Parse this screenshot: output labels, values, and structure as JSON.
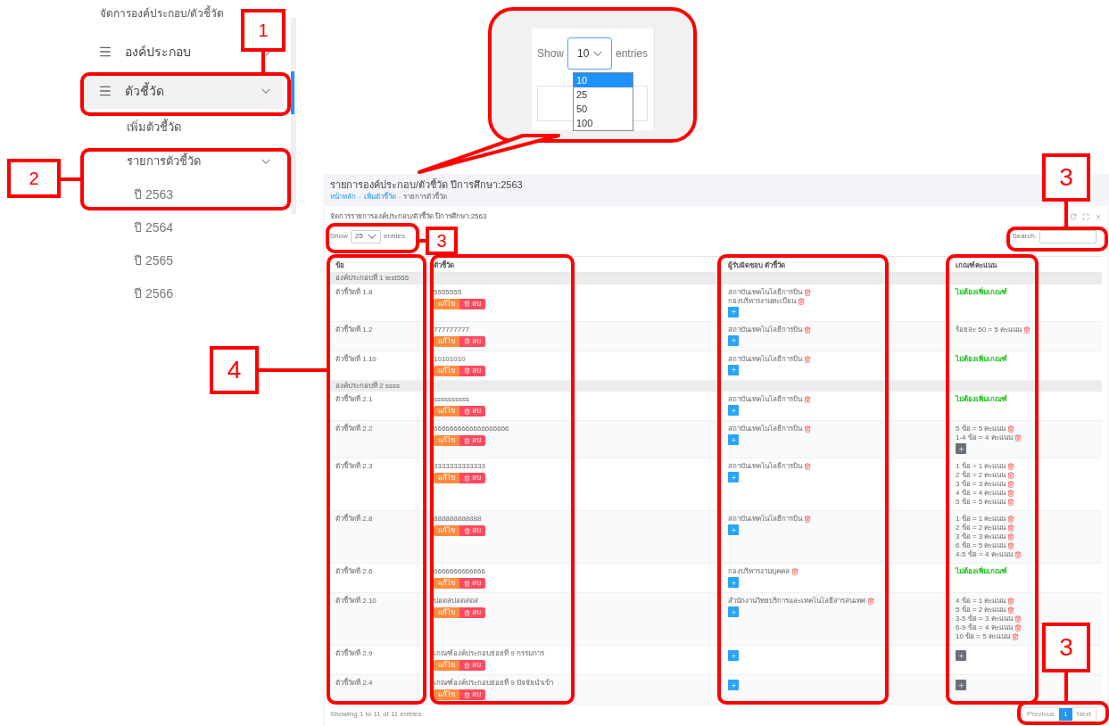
{
  "sidebar": {
    "heading": "จัดการองค์ประกอบ/ตัวชี้วัด",
    "items": [
      {
        "label": "องค์ประกอบ",
        "selected": false,
        "expanded": false
      },
      {
        "label": "ตัวชี้วัด",
        "selected": true,
        "expanded": true,
        "children": [
          {
            "label": "เพิ่มตัวชี้วัด"
          },
          {
            "label": "รายการตัวชี้วัด",
            "expanded": true,
            "children": [
              {
                "label": "ปี 2563"
              },
              {
                "label": "ปี 2564"
              },
              {
                "label": "ปี 2565"
              },
              {
                "label": "ปี 2566"
              }
            ]
          }
        ]
      }
    ]
  },
  "callout": {
    "show": "Show",
    "value": "10",
    "entries": "entries",
    "options": [
      {
        "label": "10",
        "selected": true
      },
      {
        "label": "25",
        "selected": false
      },
      {
        "label": "50",
        "selected": false
      },
      {
        "label": "100",
        "selected": false
      }
    ]
  },
  "page": {
    "title": "รายการองค์ประกอบ/ตัวชี้วัด ปีการศึกษา:2563",
    "breadcrumb": [
      {
        "label": "หน้าหลัก",
        "kind": "link"
      },
      {
        "label": "เพิ่มตัวชี้วัด",
        "kind": "link"
      },
      {
        "label": "รายการตัวชี้วัด",
        "kind": "current"
      }
    ],
    "separator": "-",
    "card_title": "จัดการรายการองค์ประกอบ/ตัวชี้วัด ปีการศึกษา:2563",
    "length": {
      "before": "Show",
      "value": "25",
      "after": "entries"
    },
    "search": {
      "label": "Search:"
    },
    "table": {
      "columns": [
        "ข้อ",
        "ตัวชี้วัด",
        "ผู้รับผิดชอบ ตัวชี้วัด",
        "เกณฑ์คะแนน"
      ],
      "rows": [
        {
          "kind": "group",
          "label": "องค์ประกอบที่ 1 test555"
        },
        {
          "kind": "item",
          "number": "ตัวชี้วัดที่ 1.8",
          "name": "5555555",
          "edit": "แก้ไข",
          "delete": "ลบ",
          "responsible": [
            "สถาบันเทคโนโลยีการบิน",
            "กองบริหารงานทะเบียน"
          ],
          "criteria": [
            {
              "kind": "note",
              "text": "ไม่ต้องเพิ่มเกณฑ์"
            }
          ],
          "add_criteria": false
        },
        {
          "kind": "item",
          "number": "ตัวชี้วัดที่ 1.2",
          "name": "777777777",
          "edit": "แก้ไข",
          "delete": "ลบ",
          "responsible": [
            "สถาบันเทคโนโลยีการบิน"
          ],
          "criteria": [
            {
              "kind": "rule",
              "text": "ร้อยละ 50 = 5 คะแนน"
            }
          ],
          "add_criteria": false
        },
        {
          "kind": "item",
          "number": "ตัวชี้วัดที่ 1.10",
          "name": "10101010",
          "edit": "แก้ไข",
          "delete": "ลบ",
          "responsible": [
            "สถาบันเทคโนโลยีการบิน"
          ],
          "criteria": [
            {
              "kind": "note",
              "text": "ไม่ต้องเพิ่มเกณฑ์"
            }
          ],
          "add_criteria": false
        },
        {
          "kind": "group",
          "label": "องค์ประกอบที่ 2 ssss"
        },
        {
          "kind": "item",
          "number": "ตัวชี้วัดที่ 2.1",
          "name": "ssssssssss",
          "edit": "แก้ไข",
          "delete": "ลบ",
          "responsible": [
            "สถาบันเทคโนโลยีการบิน"
          ],
          "criteria": [
            {
              "kind": "note",
              "text": "ไม่ต้องเพิ่มเกณฑ์"
            }
          ],
          "add_criteria": false
        },
        {
          "kind": "item",
          "number": "ตัวชี้วัดที่ 2.2",
          "name": "6666666666666666666",
          "edit": "แก้ไข",
          "delete": "ลบ",
          "responsible": [
            "สถาบันเทคโนโลยีการบิน"
          ],
          "criteria": [
            {
              "kind": "rule",
              "text": "5 ข้อ = 5 คะแนน"
            },
            {
              "kind": "rule",
              "text": "1-4 ข้อ = 4 คะแนน"
            }
          ],
          "add_criteria": true
        },
        {
          "kind": "item",
          "number": "ตัวชี้วัดที่ 2.3",
          "name": "3333333333333",
          "edit": "แก้ไข",
          "delete": "ลบ",
          "responsible": [
            "สถาบันเทคโนโลยีการบิน"
          ],
          "criteria": [
            {
              "kind": "rule",
              "text": "1 ข้อ = 1 คะแนน"
            },
            {
              "kind": "rule",
              "text": "2 ข้อ = 2 คะแนน"
            },
            {
              "kind": "rule",
              "text": "3 ข้อ = 3 คะแนน"
            },
            {
              "kind": "rule",
              "text": "4 ข้อ = 4 คะแนน"
            },
            {
              "kind": "rule",
              "text": "5 ข้อ = 5 คะแนน"
            }
          ],
          "add_criteria": false
        },
        {
          "kind": "item",
          "number": "ตัวชี้วัดที่ 2.8",
          "name": "888888888888",
          "edit": "แก้ไข",
          "delete": "ลบ",
          "responsible": [
            "สถาบันเทคโนโลยีการบิน"
          ],
          "criteria": [
            {
              "kind": "rule",
              "text": "1 ข้อ = 1 คะแนน"
            },
            {
              "kind": "rule",
              "text": "2 ข้อ = 2 คะแนน"
            },
            {
              "kind": "rule",
              "text": "3 ข้อ = 3 คะแนน"
            },
            {
              "kind": "rule",
              "text": "6 ข้อ = 5 คะแนน"
            },
            {
              "kind": "rule",
              "text": "4-5 ข้อ = 4 คะแนน"
            }
          ],
          "add_criteria": false
        },
        {
          "kind": "item",
          "number": "ตัวชี้วัดที่ 2.6",
          "name": "6666666666666",
          "edit": "แก้ไข",
          "delete": "ลบ",
          "responsible": [
            "กองบริหารงานบุคคล"
          ],
          "criteria": [
            {
              "kind": "note",
              "text": "ไม่ต้องเพิ่มเกณฑ์"
            }
          ],
          "add_criteria": false
        },
        {
          "kind": "item",
          "number": "ตัวชี้วัดที่ 2.10",
          "name": "ปอดสปอดสดส",
          "edit": "แก้ไข",
          "delete": "ลบ",
          "responsible": [
            "สำนักงานวิทยบริการและเทคโนโลยีสารสนเทศ"
          ],
          "criteria": [
            {
              "kind": "rule",
              "text": "4 ข้อ = 1 คะแนน"
            },
            {
              "kind": "rule",
              "text": "5 ข้อ = 2 คะแนน"
            },
            {
              "kind": "rule",
              "text": "3-5 ข้อ = 3 คะแนน"
            },
            {
              "kind": "rule",
              "text": "6-9 ข้อ = 4 คะแนน"
            },
            {
              "kind": "rule",
              "text": "10 ข้อ = 5 คะแนน"
            }
          ],
          "add_criteria": false
        },
        {
          "kind": "item",
          "number": "ตัวชี้วัดที่ 2.9",
          "name": "เกณฑ์องค์ประกอบย่อยที่ 9 กรรมการ",
          "edit": "แก้ไข",
          "delete": "ลบ",
          "responsible": [],
          "criteria": [],
          "add_criteria": true
        },
        {
          "kind": "item",
          "number": "ตัวชี้วัดที่ 2.4",
          "name": "เกณฑ์องค์ประกอบย่อยที่ 9 ปัจจัยนำเข้า",
          "edit": "แก้ไข",
          "delete": "ลบ",
          "responsible": [],
          "criteria": [],
          "add_criteria": true
        }
      ]
    },
    "info": "Showing 1 to 11 of 11 entries",
    "pagination": [
      {
        "label": "Previous",
        "selected": false
      },
      {
        "label": "1",
        "selected": true
      },
      {
        "label": "Next",
        "selected": false
      }
    ]
  },
  "annotations": [
    {
      "label": "1"
    },
    {
      "label": "2"
    },
    {
      "label": "3"
    },
    {
      "label": "3"
    },
    {
      "label": "3"
    },
    {
      "label": "4"
    }
  ]
}
